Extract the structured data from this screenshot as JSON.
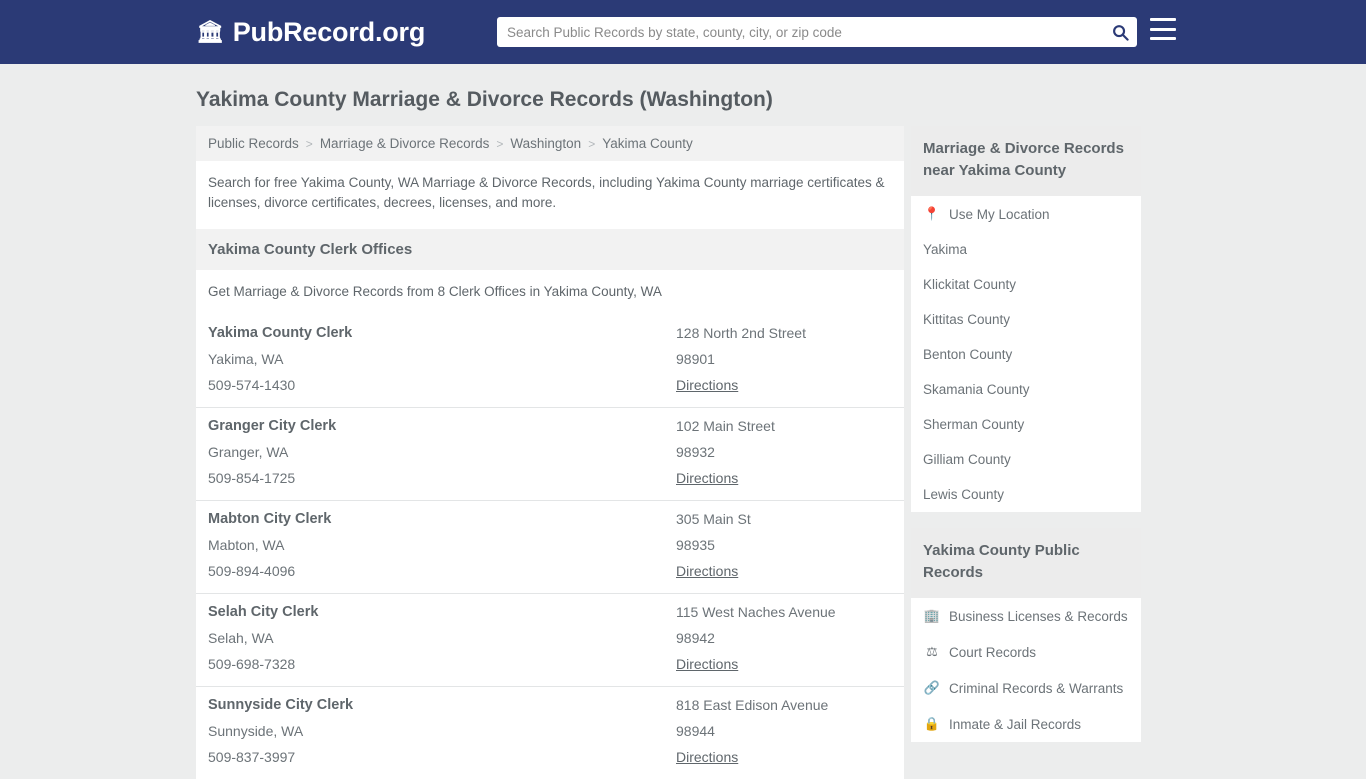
{
  "header": {
    "brand_icon": "bank-icon",
    "brand_name": "PubRecord.org",
    "search_placeholder": "Search Public Records by state, county, city, or zip code",
    "search_value": "",
    "search_icon": "search-icon",
    "menu_icon": "hamburger-menu-icon"
  },
  "page": {
    "title": "Yakima County Marriage & Divorce Records (Washington)",
    "breadcrumb": [
      "Public Records",
      "Marriage & Divorce Records",
      "Washington",
      "Yakima County"
    ],
    "breadcrumb_separator": ">",
    "intro": "Search for free Yakima County, WA Marriage & Divorce Records, including Yakima County marriage certificates & licenses, divorce certificates, decrees, licenses, and more."
  },
  "section": {
    "heading": "Yakima County Clerk Offices",
    "subheading": "Get Marriage & Divorce Records from 8 Clerk Offices in Yakima County, WA",
    "directions_label": "Directions",
    "offices": [
      {
        "name": "Yakima County Clerk",
        "city_state": "Yakima, WA",
        "phone": "509-574-1430",
        "address": "128 North 2nd Street",
        "zip": "98901"
      },
      {
        "name": "Granger City Clerk",
        "city_state": "Granger, WA",
        "phone": "509-854-1725",
        "address": "102 Main Street",
        "zip": "98932"
      },
      {
        "name": "Mabton City Clerk",
        "city_state": "Mabton, WA",
        "phone": "509-894-4096",
        "address": "305 Main St",
        "zip": "98935"
      },
      {
        "name": "Selah City Clerk",
        "city_state": "Selah, WA",
        "phone": "509-698-7328",
        "address": "115 West Naches Avenue",
        "zip": "98942"
      },
      {
        "name": "Sunnyside City Clerk",
        "city_state": "Sunnyside, WA",
        "phone": "509-837-3997",
        "address": "818 East Edison Avenue",
        "zip": "98944"
      }
    ]
  },
  "sidebar": {
    "nearby": {
      "heading": "Marriage & Divorce Records near Yakima County",
      "items": [
        {
          "label": "Use My Location",
          "icon": "location-pin-icon"
        },
        {
          "label": "Yakima",
          "icon": ""
        },
        {
          "label": "Klickitat County",
          "icon": ""
        },
        {
          "label": "Kittitas County",
          "icon": ""
        },
        {
          "label": "Benton County",
          "icon": ""
        },
        {
          "label": "Skamania County",
          "icon": ""
        },
        {
          "label": "Sherman County",
          "icon": ""
        },
        {
          "label": "Gilliam County",
          "icon": ""
        },
        {
          "label": "Lewis County",
          "icon": ""
        }
      ]
    },
    "public_records": {
      "heading": "Yakima County Public Records",
      "items": [
        {
          "label": "Business Licenses & Records",
          "icon": "building-icon"
        },
        {
          "label": "Court Records",
          "icon": "scales-icon"
        },
        {
          "label": "Criminal Records & Warrants",
          "icon": "link-icon"
        },
        {
          "label": "Inmate & Jail Records",
          "icon": "lock-icon"
        }
      ]
    }
  },
  "colors": {
    "header_bg": "#2b3a76",
    "page_bg": "#eceded",
    "panel_bg": "#f2f2f2",
    "text": "#5f666b"
  }
}
